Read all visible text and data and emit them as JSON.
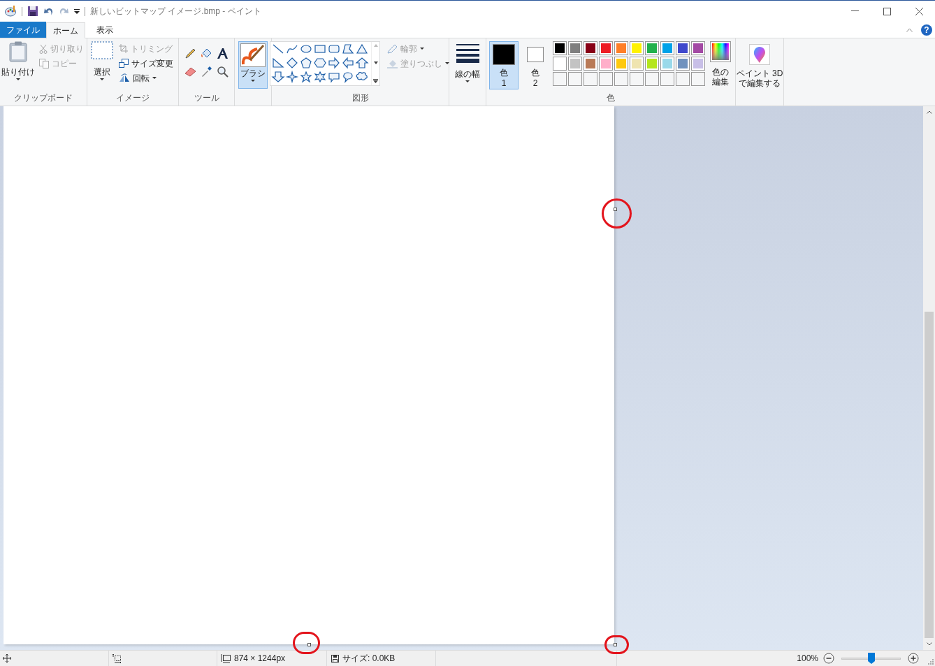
{
  "window": {
    "title": "新しいビットマップ イメージ.bmp - ペイント"
  },
  "tabs": [
    {
      "label": "ファイル",
      "kind": "file",
      "selected": false
    },
    {
      "label": "ホーム",
      "kind": "tab",
      "selected": true
    },
    {
      "label": "表示",
      "kind": "tab",
      "selected": false
    }
  ],
  "clipboard": {
    "paste": "貼り付け",
    "cut": {
      "label": "切り取り",
      "disabled": true
    },
    "copy": {
      "label": "コピー",
      "disabled": true
    },
    "group_label": "クリップボード"
  },
  "image": {
    "select": "選択",
    "crop": {
      "label": "トリミング",
      "disabled": true
    },
    "resize": {
      "label": "サイズ変更",
      "disabled": false
    },
    "rotate": "回転",
    "group_label": "イメージ"
  },
  "tools": {
    "group_label": "ツール"
  },
  "brush": {
    "label": "ブラシ",
    "selected": true
  },
  "shapes": {
    "outline": {
      "label": "輪郭",
      "disabled": true
    },
    "fill": {
      "label": "塗りつぶし",
      "disabled": true
    },
    "group_label": "図形"
  },
  "line_width": {
    "label": "線の幅"
  },
  "current_colors": [
    {
      "label": "色",
      "number": "1",
      "color": "#000000",
      "selected": true
    },
    {
      "label": "色",
      "number": "2",
      "color": "#ffffff",
      "selected": false
    }
  ],
  "palette": [
    {
      "color": "#000000"
    },
    {
      "color": "#7f7f7f"
    },
    {
      "color": "#880015"
    },
    {
      "color": "#ed1c24"
    },
    {
      "color": "#ff7f27"
    },
    {
      "color": "#fff200"
    },
    {
      "color": "#22b14c"
    },
    {
      "color": "#00a2e8"
    },
    {
      "color": "#3f48cc"
    },
    {
      "color": "#a349a4"
    },
    {
      "color": "#ffffff"
    },
    {
      "color": "#c3c3c3"
    },
    {
      "color": "#b97a57"
    },
    {
      "color": "#ffaec9"
    },
    {
      "color": "#ffc90e"
    },
    {
      "color": "#efe4b0"
    },
    {
      "color": "#b5e61d"
    },
    {
      "color": "#99d9ea"
    },
    {
      "color": "#7092be"
    },
    {
      "color": "#c8bfe7"
    }
  ],
  "edit_colors": {
    "lines": [
      "色の",
      "編集"
    ]
  },
  "colors_group_label": "色",
  "paint3d": {
    "lines": [
      "ペイント 3D",
      "で編集する"
    ]
  },
  "help": {
    "glyph": "?"
  },
  "status_bar": {
    "image_size": "874 × 1244px",
    "file_size": "サイズ: 0.0KB",
    "zoom": "100%",
    "zoom_level": {
      "level": 0.5
    }
  }
}
